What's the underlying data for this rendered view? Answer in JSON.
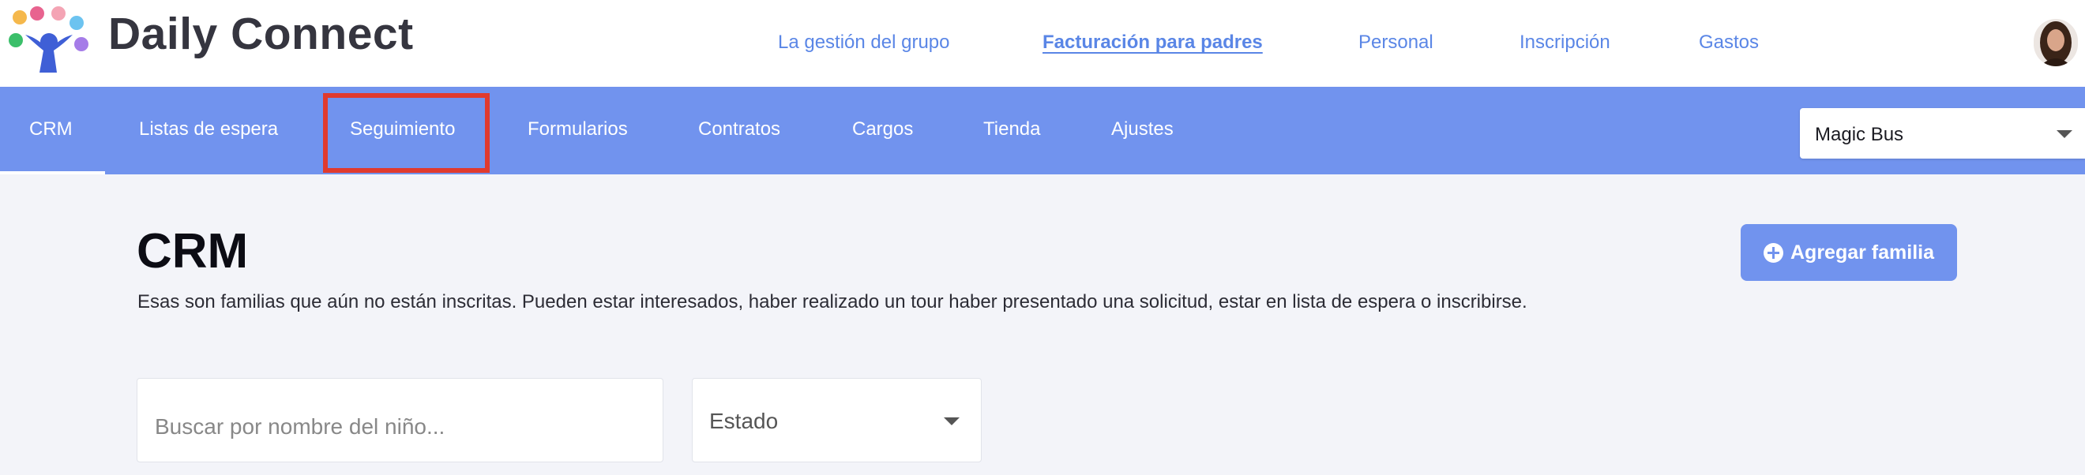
{
  "app": {
    "brand": "Daily Connect"
  },
  "topnav": [
    {
      "label": "La gestión del grupo",
      "active": false
    },
    {
      "label": "Facturación para padres",
      "active": true
    },
    {
      "label": "Personal",
      "active": false
    },
    {
      "label": "Inscripción",
      "active": false
    },
    {
      "label": "Gastos",
      "active": false
    }
  ],
  "subnav": [
    {
      "label": "CRM",
      "active": true
    },
    {
      "label": "Listas de espera",
      "active": false
    },
    {
      "label": "Seguimiento",
      "active": false,
      "highlighted": true
    },
    {
      "label": "Formularios",
      "active": false
    },
    {
      "label": "Contratos",
      "active": false
    },
    {
      "label": "Cargos",
      "active": false
    },
    {
      "label": "Tienda",
      "active": false
    },
    {
      "label": "Ajustes",
      "active": false
    }
  ],
  "center_select": {
    "value": "Magic Bus"
  },
  "main": {
    "title": "CRM",
    "description": "Esas son familias que aún no están inscritas. Pueden estar interesados, haber realizado un tour haber presentado una solicitud, estar en lista de espera o inscribirse.",
    "add_button_label": "Agregar familia"
  },
  "filters": {
    "search_placeholder": "Buscar por nombre del niño...",
    "search_value": "",
    "estado_value": "Estado"
  },
  "colors": {
    "accent": "#7193ee",
    "topnav_link": "#5a86e6",
    "highlight": "#e03a2e",
    "background": "#f3f4f9"
  },
  "icons": {
    "logo": "daily-connect-logo-icon",
    "add": "plus-circle-icon",
    "dropdown": "chevron-down-icon"
  }
}
